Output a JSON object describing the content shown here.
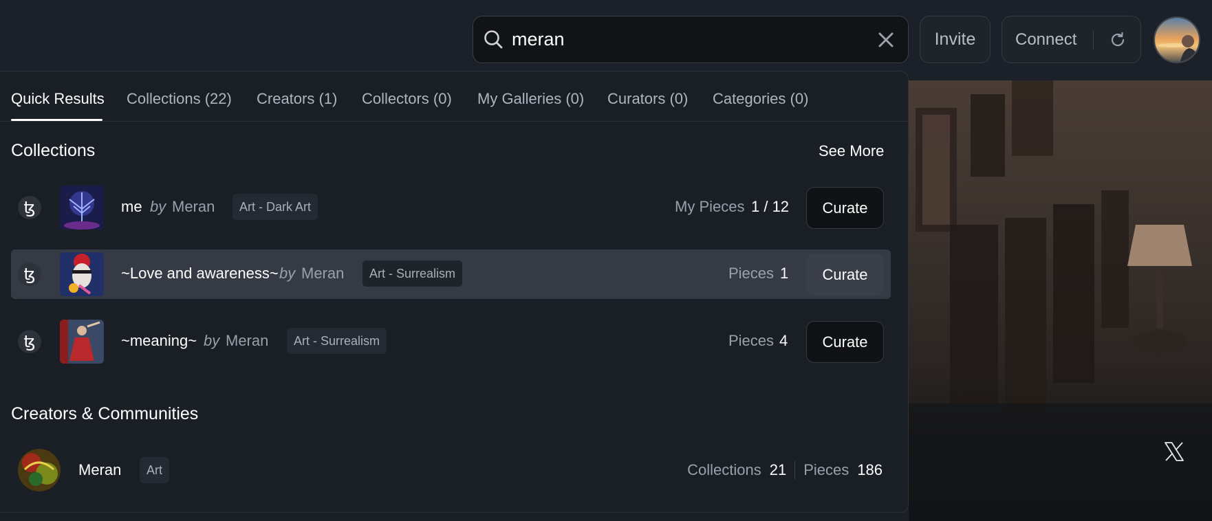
{
  "search": {
    "value": "meran"
  },
  "header": {
    "invite_label": "Invite",
    "connect_label": "Connect"
  },
  "tabs": [
    {
      "label": "Quick Results"
    },
    {
      "label": "Collections (22)"
    },
    {
      "label": "Creators (1)"
    },
    {
      "label": "Collectors (0)"
    },
    {
      "label": "My Galleries (0)"
    },
    {
      "label": "Curators (0)"
    },
    {
      "label": "Categories (0)"
    }
  ],
  "collections": {
    "title": "Collections",
    "see_more": "See More",
    "items": [
      {
        "name": "me",
        "by": "by",
        "creator": "Meran",
        "category": "Art - Dark Art",
        "stat_label": "My Pieces",
        "stat_value": "1 / 12",
        "action": "Curate",
        "chain_icon": "tezos-icon"
      },
      {
        "name": "~Love and awareness~",
        "by": "by",
        "creator": "Meran",
        "category": "Art - Surrealism",
        "stat_label": "Pieces",
        "stat_value": "1",
        "action": "Curate",
        "chain_icon": "tezos-icon"
      },
      {
        "name": "~meaning~",
        "by": "by",
        "creator": "Meran",
        "category": "Art - Surrealism",
        "stat_label": "Pieces",
        "stat_value": "4",
        "action": "Curate",
        "chain_icon": "tezos-icon"
      }
    ]
  },
  "creators": {
    "title": "Creators & Communities",
    "items": [
      {
        "name": "Meran",
        "category": "Art",
        "collections_label": "Collections",
        "collections_value": "21",
        "pieces_label": "Pieces",
        "pieces_value": "186"
      }
    ]
  },
  "colors": {
    "background": "#1b1f26",
    "panel": "#1a1e25",
    "hover_row": "#353a45",
    "text": "#ffffff",
    "muted": "#9aa1ab"
  }
}
